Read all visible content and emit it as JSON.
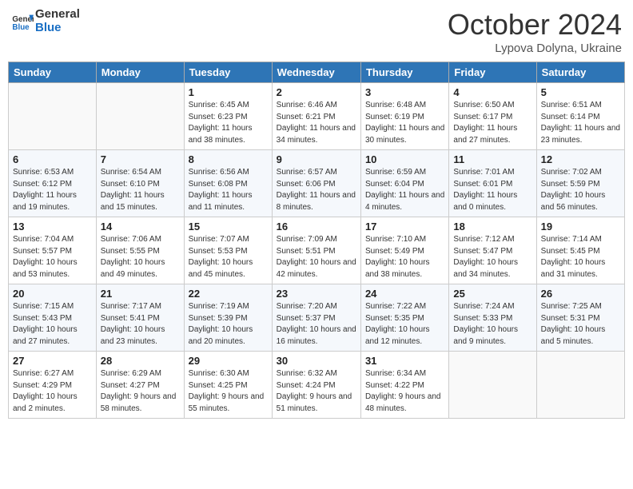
{
  "header": {
    "logo_text_general": "General",
    "logo_text_blue": "Blue",
    "month": "October 2024",
    "location": "Lypova Dolyna, Ukraine"
  },
  "days_of_week": [
    "Sunday",
    "Monday",
    "Tuesday",
    "Wednesday",
    "Thursday",
    "Friday",
    "Saturday"
  ],
  "weeks": [
    [
      {
        "day": "",
        "sunrise": "",
        "sunset": "",
        "daylight": ""
      },
      {
        "day": "",
        "sunrise": "",
        "sunset": "",
        "daylight": ""
      },
      {
        "day": "1",
        "sunrise": "Sunrise: 6:45 AM",
        "sunset": "Sunset: 6:23 PM",
        "daylight": "Daylight: 11 hours and 38 minutes."
      },
      {
        "day": "2",
        "sunrise": "Sunrise: 6:46 AM",
        "sunset": "Sunset: 6:21 PM",
        "daylight": "Daylight: 11 hours and 34 minutes."
      },
      {
        "day": "3",
        "sunrise": "Sunrise: 6:48 AM",
        "sunset": "Sunset: 6:19 PM",
        "daylight": "Daylight: 11 hours and 30 minutes."
      },
      {
        "day": "4",
        "sunrise": "Sunrise: 6:50 AM",
        "sunset": "Sunset: 6:17 PM",
        "daylight": "Daylight: 11 hours and 27 minutes."
      },
      {
        "day": "5",
        "sunrise": "Sunrise: 6:51 AM",
        "sunset": "Sunset: 6:14 PM",
        "daylight": "Daylight: 11 hours and 23 minutes."
      }
    ],
    [
      {
        "day": "6",
        "sunrise": "Sunrise: 6:53 AM",
        "sunset": "Sunset: 6:12 PM",
        "daylight": "Daylight: 11 hours and 19 minutes."
      },
      {
        "day": "7",
        "sunrise": "Sunrise: 6:54 AM",
        "sunset": "Sunset: 6:10 PM",
        "daylight": "Daylight: 11 hours and 15 minutes."
      },
      {
        "day": "8",
        "sunrise": "Sunrise: 6:56 AM",
        "sunset": "Sunset: 6:08 PM",
        "daylight": "Daylight: 11 hours and 11 minutes."
      },
      {
        "day": "9",
        "sunrise": "Sunrise: 6:57 AM",
        "sunset": "Sunset: 6:06 PM",
        "daylight": "Daylight: 11 hours and 8 minutes."
      },
      {
        "day": "10",
        "sunrise": "Sunrise: 6:59 AM",
        "sunset": "Sunset: 6:04 PM",
        "daylight": "Daylight: 11 hours and 4 minutes."
      },
      {
        "day": "11",
        "sunrise": "Sunrise: 7:01 AM",
        "sunset": "Sunset: 6:01 PM",
        "daylight": "Daylight: 11 hours and 0 minutes."
      },
      {
        "day": "12",
        "sunrise": "Sunrise: 7:02 AM",
        "sunset": "Sunset: 5:59 PM",
        "daylight": "Daylight: 10 hours and 56 minutes."
      }
    ],
    [
      {
        "day": "13",
        "sunrise": "Sunrise: 7:04 AM",
        "sunset": "Sunset: 5:57 PM",
        "daylight": "Daylight: 10 hours and 53 minutes."
      },
      {
        "day": "14",
        "sunrise": "Sunrise: 7:06 AM",
        "sunset": "Sunset: 5:55 PM",
        "daylight": "Daylight: 10 hours and 49 minutes."
      },
      {
        "day": "15",
        "sunrise": "Sunrise: 7:07 AM",
        "sunset": "Sunset: 5:53 PM",
        "daylight": "Daylight: 10 hours and 45 minutes."
      },
      {
        "day": "16",
        "sunrise": "Sunrise: 7:09 AM",
        "sunset": "Sunset: 5:51 PM",
        "daylight": "Daylight: 10 hours and 42 minutes."
      },
      {
        "day": "17",
        "sunrise": "Sunrise: 7:10 AM",
        "sunset": "Sunset: 5:49 PM",
        "daylight": "Daylight: 10 hours and 38 minutes."
      },
      {
        "day": "18",
        "sunrise": "Sunrise: 7:12 AM",
        "sunset": "Sunset: 5:47 PM",
        "daylight": "Daylight: 10 hours and 34 minutes."
      },
      {
        "day": "19",
        "sunrise": "Sunrise: 7:14 AM",
        "sunset": "Sunset: 5:45 PM",
        "daylight": "Daylight: 10 hours and 31 minutes."
      }
    ],
    [
      {
        "day": "20",
        "sunrise": "Sunrise: 7:15 AM",
        "sunset": "Sunset: 5:43 PM",
        "daylight": "Daylight: 10 hours and 27 minutes."
      },
      {
        "day": "21",
        "sunrise": "Sunrise: 7:17 AM",
        "sunset": "Sunset: 5:41 PM",
        "daylight": "Daylight: 10 hours and 23 minutes."
      },
      {
        "day": "22",
        "sunrise": "Sunrise: 7:19 AM",
        "sunset": "Sunset: 5:39 PM",
        "daylight": "Daylight: 10 hours and 20 minutes."
      },
      {
        "day": "23",
        "sunrise": "Sunrise: 7:20 AM",
        "sunset": "Sunset: 5:37 PM",
        "daylight": "Daylight: 10 hours and 16 minutes."
      },
      {
        "day": "24",
        "sunrise": "Sunrise: 7:22 AM",
        "sunset": "Sunset: 5:35 PM",
        "daylight": "Daylight: 10 hours and 12 minutes."
      },
      {
        "day": "25",
        "sunrise": "Sunrise: 7:24 AM",
        "sunset": "Sunset: 5:33 PM",
        "daylight": "Daylight: 10 hours and 9 minutes."
      },
      {
        "day": "26",
        "sunrise": "Sunrise: 7:25 AM",
        "sunset": "Sunset: 5:31 PM",
        "daylight": "Daylight: 10 hours and 5 minutes."
      }
    ],
    [
      {
        "day": "27",
        "sunrise": "Sunrise: 6:27 AM",
        "sunset": "Sunset: 4:29 PM",
        "daylight": "Daylight: 10 hours and 2 minutes."
      },
      {
        "day": "28",
        "sunrise": "Sunrise: 6:29 AM",
        "sunset": "Sunset: 4:27 PM",
        "daylight": "Daylight: 9 hours and 58 minutes."
      },
      {
        "day": "29",
        "sunrise": "Sunrise: 6:30 AM",
        "sunset": "Sunset: 4:25 PM",
        "daylight": "Daylight: 9 hours and 55 minutes."
      },
      {
        "day": "30",
        "sunrise": "Sunrise: 6:32 AM",
        "sunset": "Sunset: 4:24 PM",
        "daylight": "Daylight: 9 hours and 51 minutes."
      },
      {
        "day": "31",
        "sunrise": "Sunrise: 6:34 AM",
        "sunset": "Sunset: 4:22 PM",
        "daylight": "Daylight: 9 hours and 48 minutes."
      },
      {
        "day": "",
        "sunrise": "",
        "sunset": "",
        "daylight": ""
      },
      {
        "day": "",
        "sunrise": "",
        "sunset": "",
        "daylight": ""
      }
    ]
  ]
}
